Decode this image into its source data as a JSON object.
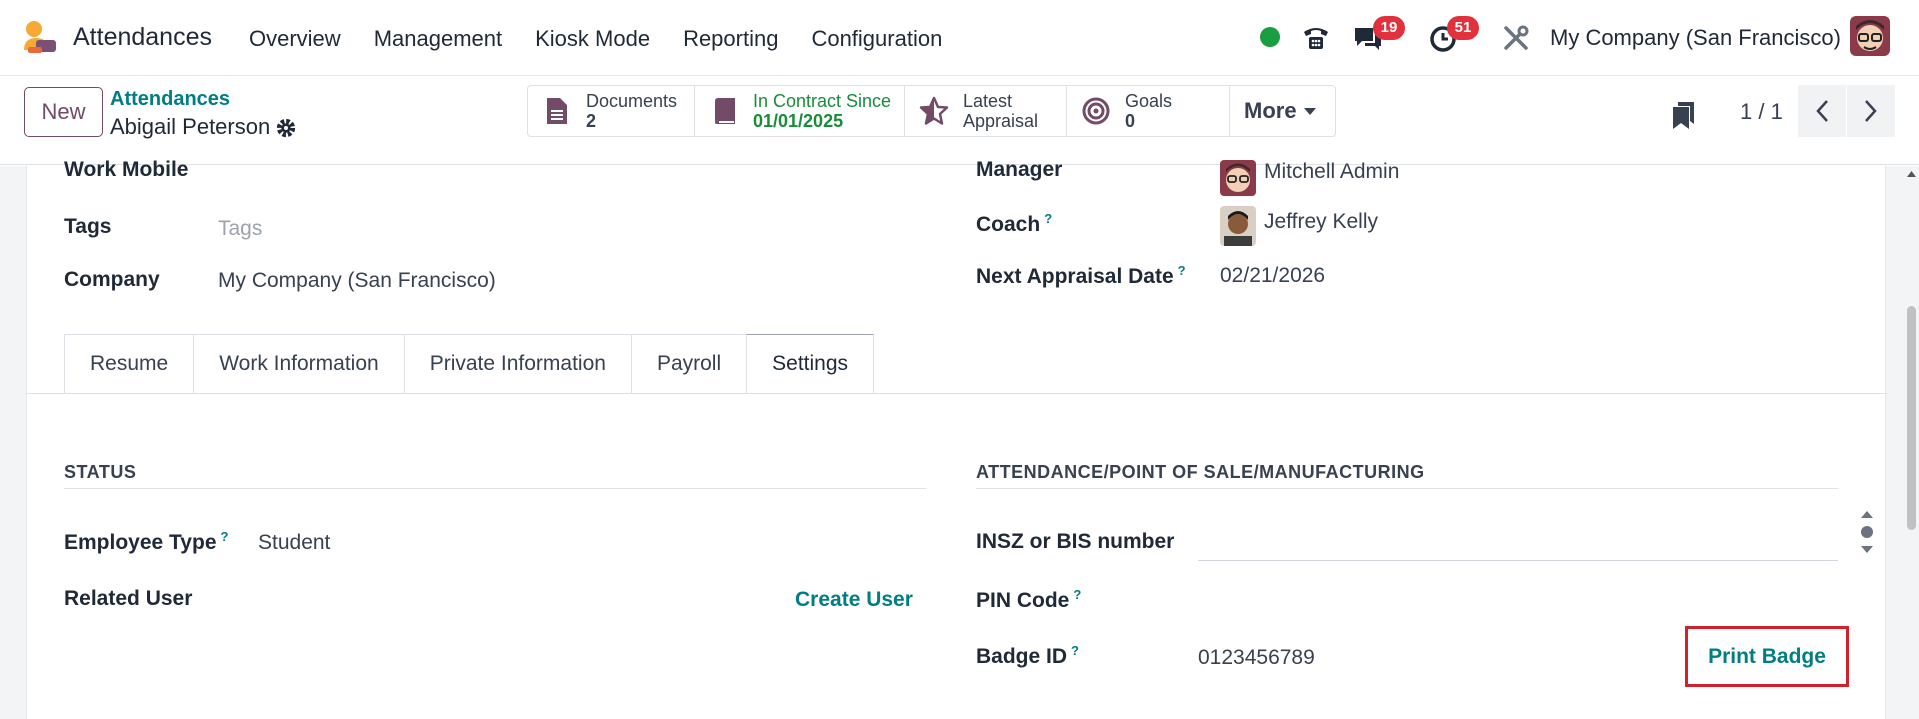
{
  "navbar": {
    "app_name": "Attendances",
    "menu": [
      "Overview",
      "Management",
      "Kiosk Mode",
      "Reporting",
      "Configuration"
    ],
    "messages_count": "19",
    "activities_count": "51",
    "company": "My Company (San Francisco)",
    "status_color": "#1a9e3f"
  },
  "control_panel": {
    "new_label": "New",
    "breadcrumb_parent": "Attendances",
    "breadcrumb_record": "Abigail Peterson",
    "smart_buttons": {
      "documents_label": "Documents",
      "documents_value": "2",
      "contract_label": "In Contract Since",
      "contract_value": "01/01/2025",
      "appraisal_line1": "Latest",
      "appraisal_line2": "Appraisal",
      "goals_label": "Goals",
      "goals_value": "0",
      "more_label": "More"
    },
    "pager": "1 / 1"
  },
  "form": {
    "work_mobile_label": "Work Mobile",
    "tags_label": "Tags",
    "tags_placeholder": "Tags",
    "company_label": "Company",
    "company_value": "My Company (San Francisco)",
    "manager_label": "Manager",
    "manager_value": "Mitchell Admin",
    "coach_label": "Coach",
    "coach_value": "Jeffrey Kelly",
    "next_appraisal_label": "Next Appraisal Date",
    "next_appraisal_value": "02/21/2026",
    "help_mark": "?"
  },
  "tabs": [
    "Resume",
    "Work Information",
    "Private Information",
    "Payroll",
    "Settings"
  ],
  "settings": {
    "status_title": "STATUS",
    "employee_type_label": "Employee Type",
    "employee_type_value": "Student",
    "related_user_label": "Related User",
    "create_user_label": "Create User",
    "attendance_title": "ATTENDANCE/POINT OF SALE/MANUFACTURING",
    "insz_label": "INSZ or BIS number",
    "pin_label": "PIN Code",
    "badge_label": "Badge ID",
    "badge_value": "0123456789",
    "print_badge_label": "Print Badge"
  }
}
